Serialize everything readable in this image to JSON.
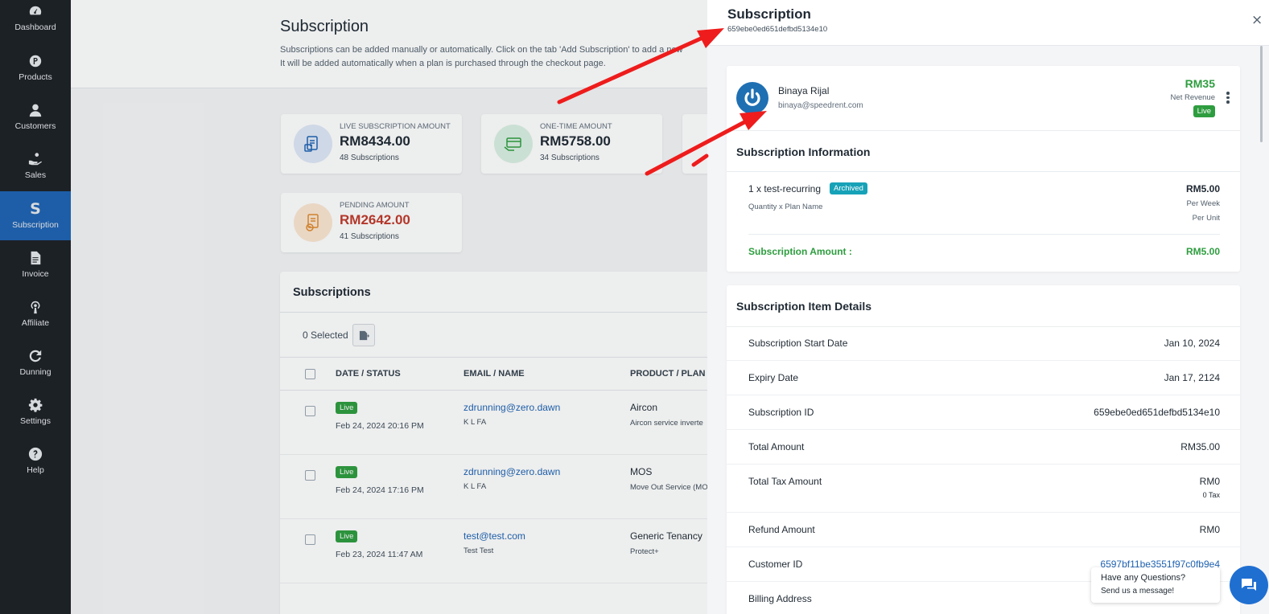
{
  "sidebar": {
    "items": [
      {
        "label": "Dashboard",
        "icon": "gauge-icon",
        "active": false
      },
      {
        "label": "Products",
        "icon": "product-p-icon",
        "active": false
      },
      {
        "label": "Customers",
        "icon": "user-icon",
        "active": false
      },
      {
        "label": "Sales",
        "icon": "hand-coin-icon",
        "active": false
      },
      {
        "label": "Subscription",
        "icon": "dollar-icon",
        "glyph": "S",
        "active": true
      },
      {
        "label": "Invoice",
        "icon": "document-icon",
        "active": false
      },
      {
        "label": "Affiliate",
        "icon": "broadcast-icon",
        "active": false
      },
      {
        "label": "Dunning",
        "icon": "refresh-icon",
        "active": false
      },
      {
        "label": "Settings",
        "icon": "gear-icon",
        "active": false
      },
      {
        "label": "Help",
        "icon": "question-icon",
        "active": false
      }
    ]
  },
  "main": {
    "title": "Subscription",
    "desc_line1": "Subscriptions can be added manually or automatically. Click on the tab 'Add Subscription' to add a new",
    "desc_line2": "It will be added automatically when a plan is purchased through the checkout page.",
    "stats": [
      {
        "label": "LIVE SUBSCRIPTION AMOUNT",
        "value": "RM8434.00",
        "sub": "48 Subscriptions",
        "icon": "card-icon",
        "tint": "#dfe8f7",
        "stroke": "#1f63b3",
        "value_color": "#1f2933"
      },
      {
        "label": "ONE-TIME AMOUNT",
        "value": "RM5758.00",
        "sub": "34 Subscriptions",
        "icon": "payment-icon",
        "tint": "#dbf0e3",
        "stroke": "#2e9d3f",
        "value_color": "#1f2933"
      },
      {
        "label": "PENDING AMOUNT",
        "value": "RM2642.00",
        "sub": "41 Subscriptions",
        "icon": "pending-icon",
        "tint": "#fbe6d2",
        "stroke": "#e08a2e",
        "value_color": "#c0392b"
      }
    ],
    "subscriptions": {
      "title": "Subscriptions",
      "selected": "0 Selected",
      "columns": [
        "DATE / STATUS",
        "EMAIL / NAME",
        "PRODUCT / PLAN"
      ],
      "rows": [
        {
          "status": "Live",
          "date": "Feb 24, 2024 20:16 PM",
          "email": "zdrunning@zero.dawn",
          "name": "K L FA",
          "product": "Aircon",
          "plan": "Aircon service inverte"
        },
        {
          "status": "Live",
          "date": "Feb 24, 2024 17:16 PM",
          "email": "zdrunning@zero.dawn",
          "name": "K L FA",
          "product": "MOS",
          "plan": "Move Out Service (MO"
        },
        {
          "status": "Live",
          "date": "Feb 23, 2024 11:47 AM",
          "email": "test@test.com",
          "name": "Test Test",
          "product": "Generic Tenancy",
          "plan": "Protect+"
        }
      ]
    }
  },
  "drawer": {
    "title": "Subscription",
    "id": "659ebe0ed651defbd5134e10",
    "close": "×",
    "customer": {
      "name": "Binaya Rijal",
      "email": "binaya@speedrent.com",
      "net_amount": "RM35",
      "net_label": "Net Revenue",
      "status": "Live"
    },
    "info": {
      "title": "Subscription Information",
      "item": "1 x test-recurring",
      "item_badge": "Archived",
      "item_sub": "Quantity x Plan Name",
      "price": "RM5.00",
      "price_note1": "Per Week",
      "price_note2": "Per Unit",
      "amount_label": "Subscription Amount :",
      "amount_value": "RM5.00"
    },
    "details": {
      "title": "Subscription Item Details",
      "rows": [
        {
          "label": "Subscription Start Date",
          "value": "Jan 10, 2024"
        },
        {
          "label": "Expiry Date",
          "value": "Jan 17, 2124"
        },
        {
          "label": "Subscription ID",
          "value": "659ebe0ed651defbd5134e10"
        },
        {
          "label": "Total Amount",
          "value": "RM35.00"
        },
        {
          "label": "Total Tax Amount",
          "value": "RM0",
          "sub": "0 Tax"
        },
        {
          "label": "Refund Amount",
          "value": "RM0"
        },
        {
          "label": "Customer ID",
          "value": "6597bf11be3551f97c0fb9e4"
        },
        {
          "label": "Billing Address",
          "value": ""
        }
      ]
    }
  },
  "chat": {
    "line1": "Have any Questions?",
    "line2": "Send us a message!"
  },
  "colors": {
    "accent": "#1f63b3",
    "live": "#2e9d3f",
    "archived": "#17a2b8",
    "arrow": "#ee1c1c"
  }
}
